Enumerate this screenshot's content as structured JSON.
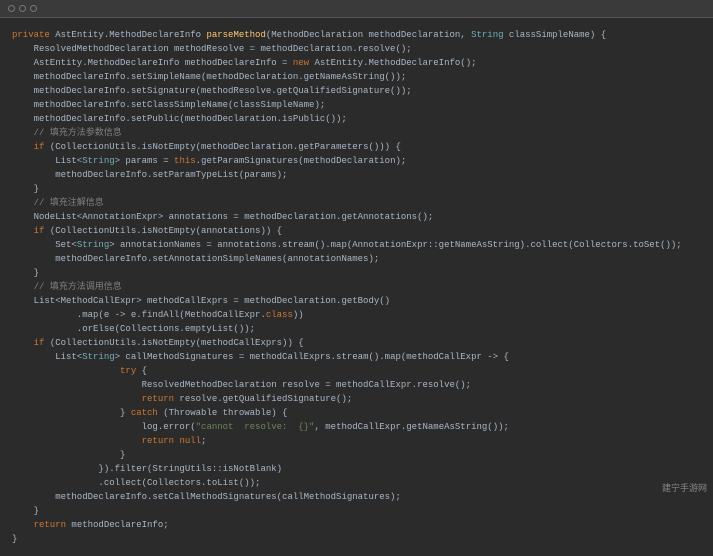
{
  "titlebar": {
    "dot_count": 3
  },
  "code": {
    "t01a": "private",
    "t01b": " AstEntity.MethodDeclareInfo ",
    "t01c": "parseMethod",
    "t01d": "(MethodDeclaration methodDeclaration, ",
    "t01e": "String",
    "t01f": " classSimpleName) {",
    "t02": "    ResolvedMethodDeclaration methodResolve = methodDeclaration.resolve();",
    "t03a": "    AstEntity.MethodDeclareInfo methodDeclareInfo = ",
    "t03b": "new",
    "t03c": " AstEntity.MethodDeclareInfo();",
    "t04": "    methodDeclareInfo.setSimpleName(methodDeclaration.getNameAsString());",
    "t05": "    methodDeclareInfo.setSignature(methodResolve.getQualifiedSignature());",
    "t06": "    methodDeclareInfo.setClassSimpleName(classSimpleName);",
    "t07": "    methodDeclareInfo.setPublic(methodDeclaration.isPublic());",
    "t08": "    // 填充方法参数信息",
    "t09a": "    ",
    "t09b": "if",
    "t09c": " (CollectionUtils.isNotEmpty(methodDeclaration.getParameters())) {",
    "t10a": "        List<",
    "t10b": "String",
    "t10c": "> params = ",
    "t10d": "this",
    "t10e": ".getParamSignatures(methodDeclaration);",
    "t11": "        methodDeclareInfo.setParamTypeList(params);",
    "t12": "    }",
    "t13": "    // 填充注解信息",
    "t14": "    NodeList<AnnotationExpr> annotations = methodDeclaration.getAnnotations();",
    "t15a": "    ",
    "t15b": "if",
    "t15c": " (CollectionUtils.isNotEmpty(annotations)) {",
    "t16a": "        Set<",
    "t16b": "String",
    "t16c": "> annotationNames = annotations.stream().map(AnnotationExpr::getNameAsString).collect(Collectors.toSet());",
    "t17": "        methodDeclareInfo.setAnnotationSimpleNames(annotationNames);",
    "t18": "    }",
    "t19": "    // 填充方法调用信息",
    "t20": "    List<MethodCallExpr> methodCallExprs = methodDeclaration.getBody()",
    "t21a": "            .map(e -> e.findAll(MethodCallExpr.",
    "t21b": "class",
    "t21c": "))",
    "t22": "            .orElse(Collections.emptyList());",
    "t23a": "    ",
    "t23b": "if",
    "t23c": " (CollectionUtils.isNotEmpty(methodCallExprs)) {",
    "t24a": "        List<",
    "t24b": "String",
    "t24c": "> callMethodSignatures = methodCallExprs.stream().map(methodCallExpr -> {",
    "t25a": "                    ",
    "t25b": "try",
    "t25c": " {",
    "t26": "                        ResolvedMethodDeclaration resolve = methodCallExpr.resolve();",
    "t27a": "                        ",
    "t27b": "return",
    "t27c": " resolve.getQualifiedSignature();",
    "t28a": "                    } ",
    "t28b": "catch",
    "t28c": " (Throwable throwable) {",
    "t29a": "                        log.error(",
    "t29b": "\"cannot  resolve:  {}\"",
    "t29c": ", methodCallExpr.getNameAsString());",
    "t30a": "                        ",
    "t30b": "return",
    "t30c": " ",
    "t30d": "null",
    "t30e": ";",
    "t31": "                    }",
    "t32": "                }).filter(StringUtils::isNotBlank)",
    "t33": "                .collect(Collectors.toList());",
    "t34": "        methodDeclareInfo.setCallMethodSignatures(callMethodSignatures);",
    "t35": "    }",
    "t36a": "    ",
    "t36b": "return",
    "t36c": " methodDeclareInfo;",
    "t37": "}"
  },
  "watermark": "建宁手游网"
}
